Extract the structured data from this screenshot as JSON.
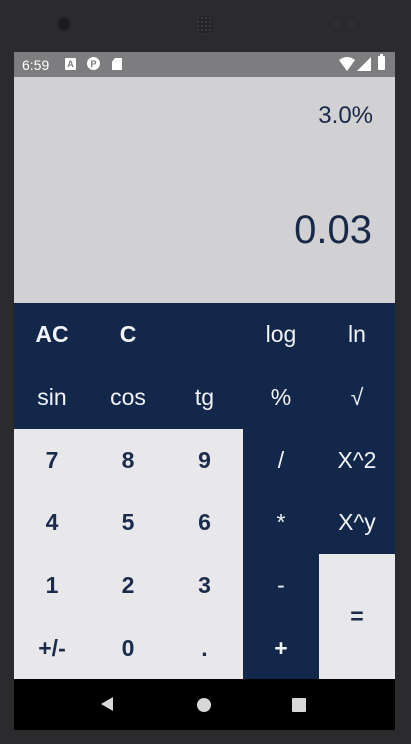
{
  "status_bar": {
    "time": "6:59",
    "icons": [
      "a-notification-icon",
      "p-notification-icon",
      "sd-card-icon",
      "wifi-icon",
      "signal-icon",
      "battery-icon"
    ]
  },
  "display": {
    "expression": "3.0%",
    "result": "0.03"
  },
  "keys": {
    "ac": "AC",
    "c": "C",
    "log": "log",
    "ln": "ln",
    "sin": "sin",
    "cos": "cos",
    "tg": "tg",
    "percent": "%",
    "sqrt": "√",
    "d7": "7",
    "d8": "8",
    "d9": "9",
    "divide": "/",
    "square": "X^2",
    "d4": "4",
    "d5": "5",
    "d6": "6",
    "multiply": "*",
    "power": "X^y",
    "d1": "1",
    "d2": "2",
    "d3": "3",
    "minus": "-",
    "equals": "=",
    "sign": "+/-",
    "d0": "0",
    "dot": ".",
    "plus": "+"
  },
  "colors": {
    "keypad_dark": "#13274a",
    "keypad_light": "#e8e8ea",
    "display_bg": "#d1d0d2",
    "display_text": "#182848"
  }
}
